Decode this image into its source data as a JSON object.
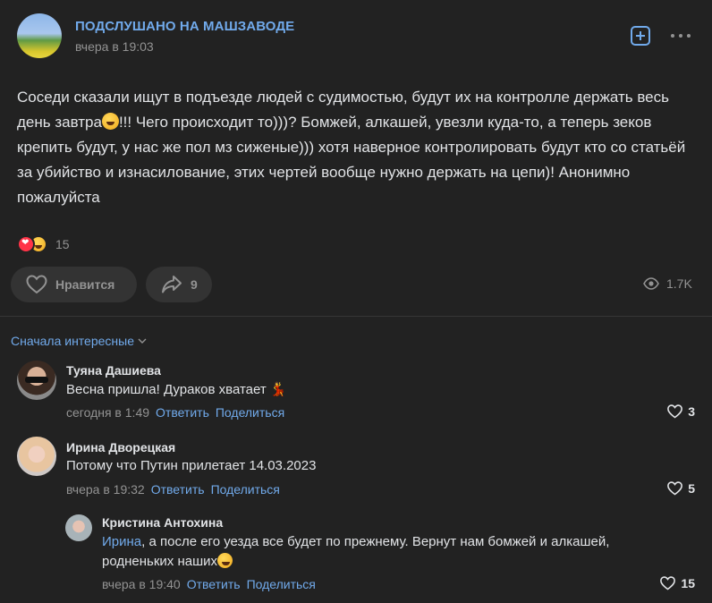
{
  "post": {
    "group_name": "ПОДСЛУШАНО НА МАШЗАВОДЕ",
    "time": "вчера в 19:03",
    "text_parts": [
      "Соседи сказали ищут в подъезде людей с судимостью, будут их на контролле держать весь день завтра",
      "!!! Чего происходит то)))? Бомжей, алкашей, увезли куда-то, а теперь зеков крепить будут, у нас же пол мз сиженые))) хотя наверное контролировать будут кто со статьёй за убийство и изнасилование, этих чертей вообще нужно держать на цепи)! Анонимно пожалуйста"
    ],
    "reactions_count": "15",
    "like_label": "Нравится",
    "share_count": "9",
    "views": "1.7K"
  },
  "comments_sort": "Сначала интересные",
  "comments": [
    {
      "name": "Туяна Дашиева",
      "text": "Весна пришла! Дураков хватает",
      "time": "сегодня в 1:49",
      "reply": "Ответить",
      "share": "Поделиться",
      "likes": "3"
    },
    {
      "name": "Ирина Дворецкая",
      "text": "Потому что Путин прилетает 14.03.2023",
      "time": "вчера в 19:32",
      "reply": "Ответить",
      "share": "Поделиться",
      "likes": "5"
    },
    {
      "name": "Кристина Антохина",
      "mention": "Ирина",
      "text": ", а после его уезда все будет по прежнему. Вернут нам бомжей и алкашей, родненьких наших",
      "time": "вчера в 19:40",
      "reply": "Ответить",
      "share": "Поделиться",
      "likes": "15"
    }
  ],
  "colors": {
    "background": "#222222",
    "accent": "#71aaeb",
    "text": "#e1e3e6",
    "secondary": "#939393"
  }
}
